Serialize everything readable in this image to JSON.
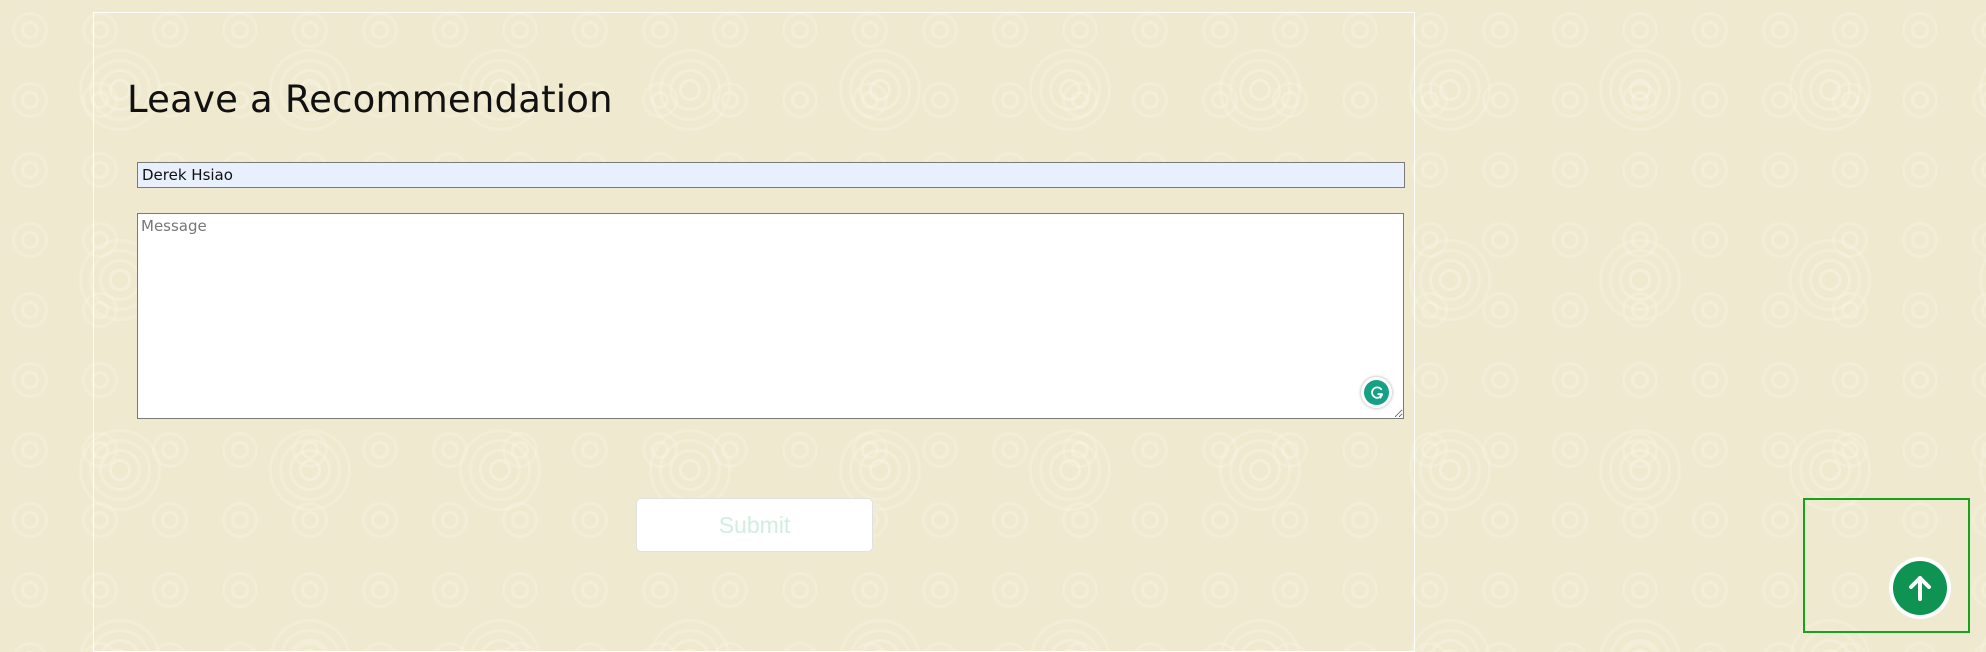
{
  "form": {
    "title": "Leave a Recommendation",
    "name_value": "Derek Hsiao",
    "message_placeholder": "Message",
    "submit_label": "Submit"
  },
  "icons": {
    "grammarly": "grammarly-icon",
    "scroll_top": "arrow-up-icon"
  },
  "colors": {
    "background": "#efeacf",
    "input_autofill": "#e8f0fe",
    "grammarly": "#15a183",
    "scroll_button": "#0f9353",
    "highlight_frame": "#17a21d",
    "submit_text": "#cfeee0"
  }
}
